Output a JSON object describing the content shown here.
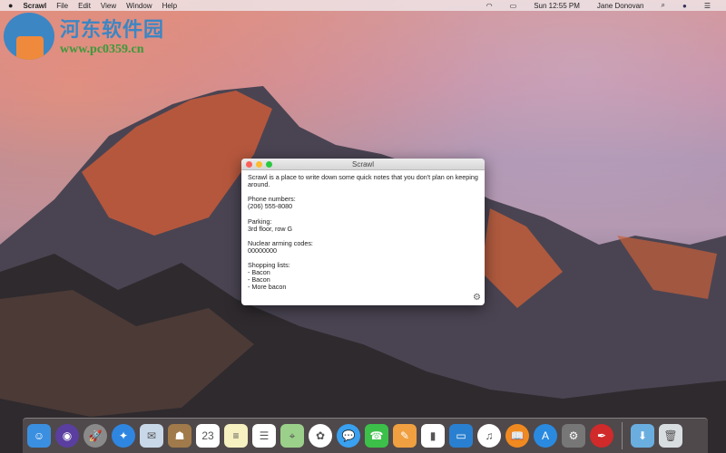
{
  "menubar": {
    "app": "Scrawl",
    "items": [
      "File",
      "Edit",
      "View",
      "Window",
      "Help"
    ],
    "clock": "Sun 12:55 PM",
    "user": "Jane Donovan"
  },
  "watermark": {
    "name": "河东软件园",
    "url": "www.pc0359.cn"
  },
  "window": {
    "title": "Scrawl",
    "text": "Scrawl is a place to write down some quick notes that you don't plan on keeping around.\n\nPhone numbers:\n(206) 555-8080\n\nParking:\n3rd floor, row G\n\nNuclear arming codes:\n00000000\n\nShopping lists:\n- Bacon\n- Bacon\n- More bacon"
  },
  "dock": [
    {
      "name": "finder",
      "color": "#3b8fe0",
      "glyph": "☺"
    },
    {
      "name": "siri",
      "color": "#5a3fa0",
      "glyph": "◉"
    },
    {
      "name": "launchpad",
      "color": "#8a8a8a",
      "glyph": "🚀"
    },
    {
      "name": "safari",
      "color": "#2f86e0",
      "glyph": "✦"
    },
    {
      "name": "mail",
      "color": "#c9d8e8",
      "glyph": "✉"
    },
    {
      "name": "contacts",
      "color": "#a07a4a",
      "glyph": "☗"
    },
    {
      "name": "calendar",
      "color": "#ffffff",
      "glyph": "23"
    },
    {
      "name": "notes",
      "color": "#f7f0c0",
      "glyph": "≡"
    },
    {
      "name": "reminders",
      "color": "#ffffff",
      "glyph": "☰"
    },
    {
      "name": "maps",
      "color": "#9bd08a",
      "glyph": "⌖"
    },
    {
      "name": "photos",
      "color": "#ffffff",
      "glyph": "✿"
    },
    {
      "name": "messages",
      "color": "#3aa0f0",
      "glyph": "💬"
    },
    {
      "name": "facetime",
      "color": "#3cc04a",
      "glyph": "☎"
    },
    {
      "name": "pages",
      "color": "#f0a040",
      "glyph": "✎"
    },
    {
      "name": "numbers",
      "color": "#ffffff",
      "glyph": "▮"
    },
    {
      "name": "keynote",
      "color": "#2a80d0",
      "glyph": "▭"
    },
    {
      "name": "itunes",
      "color": "#ffffff",
      "glyph": "♫"
    },
    {
      "name": "ibooks",
      "color": "#f08a20",
      "glyph": "📖"
    },
    {
      "name": "app-store",
      "color": "#2a8ae0",
      "glyph": "A"
    },
    {
      "name": "system-preferences",
      "color": "#777777",
      "glyph": "⚙"
    },
    {
      "name": "scrawl",
      "color": "#d02a2a",
      "glyph": "✒"
    },
    {
      "name": "downloads",
      "color": "#6aaee0",
      "glyph": "⬇"
    },
    {
      "name": "trash",
      "color": "#d8dde0",
      "glyph": "🗑"
    }
  ]
}
